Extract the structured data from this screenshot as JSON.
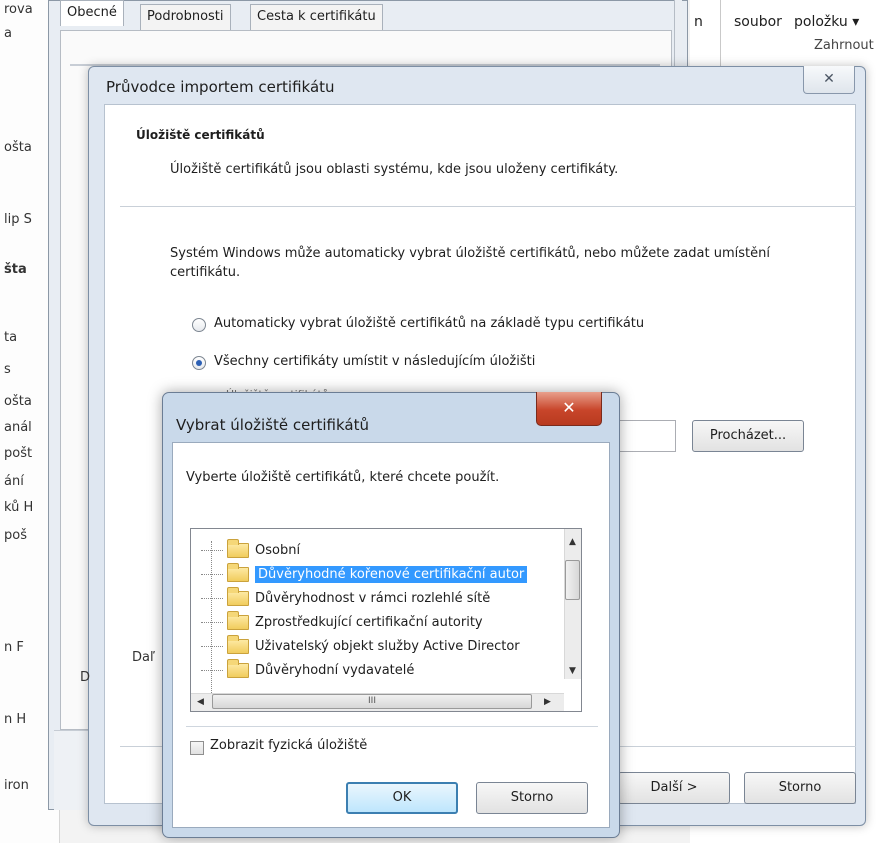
{
  "background_app": {
    "left_items": [
      "rova",
      "a",
      "ošta",
      "lip S",
      "šta",
      "ta",
      "s",
      "ošta",
      "anál",
      "pošt",
      "ání",
      "ků H",
      "poš",
      "n F",
      "n H",
      "iron"
    ],
    "right_top_labels": [
      "n",
      "soubor",
      "položku ▾"
    ],
    "right_link": "Zahrnout"
  },
  "properties_dialog": {
    "tabs": [
      "Obecné",
      "Podrobnosti",
      "Cesta k certifikátu"
    ]
  },
  "wizard": {
    "title": "Průvodce importem certifikátu",
    "close_glyph": "✕",
    "section_title": "Úložiště certifikátů",
    "section_subtitle": "Úložiště certifikátů jsou oblasti systému, kde jsou uloženy certifikáty.",
    "body_text": "Systém Windows může automaticky vybrat úložiště certifikátů, nebo můžete zadat umístění certifikátu.",
    "radio_auto": "Automaticky vybrat úložiště certifikátů na základě typu certifikátu",
    "radio_manual": "Všechny certifikáty umístit v následujícím úložišti",
    "partial_store_label": "Úložiště certifikátů:",
    "browse_button": "Procházet...",
    "more_link_partial": "Daľ",
    "d_partial": "D",
    "next_button": "Další >",
    "cancel_button": "Storno"
  },
  "store_dialog": {
    "title": "Vybrat úložiště certifikátů",
    "close_glyph": "✕",
    "description": "Vyberte úložiště certifikátů, které chcete použít.",
    "stores": [
      "Osobní",
      "Důvěryhodné kořenové certifikační autor",
      "Důvěryhodnost v rámci rozlehlé sítě",
      "Zprostředkující certifikační autority",
      "Uživatelský objekt služby Active Director",
      "Důvěryhodní vydavatelé"
    ],
    "selected_index": 1,
    "show_physical_label": "Zobrazit fyzická úložiště",
    "show_physical_checked": false,
    "ok_button": "OK",
    "cancel_button": "Storno",
    "hscroll_grip": "III",
    "arrow_up": "▲",
    "arrow_down": "▼",
    "arrow_left": "◀",
    "arrow_right": "▶"
  }
}
